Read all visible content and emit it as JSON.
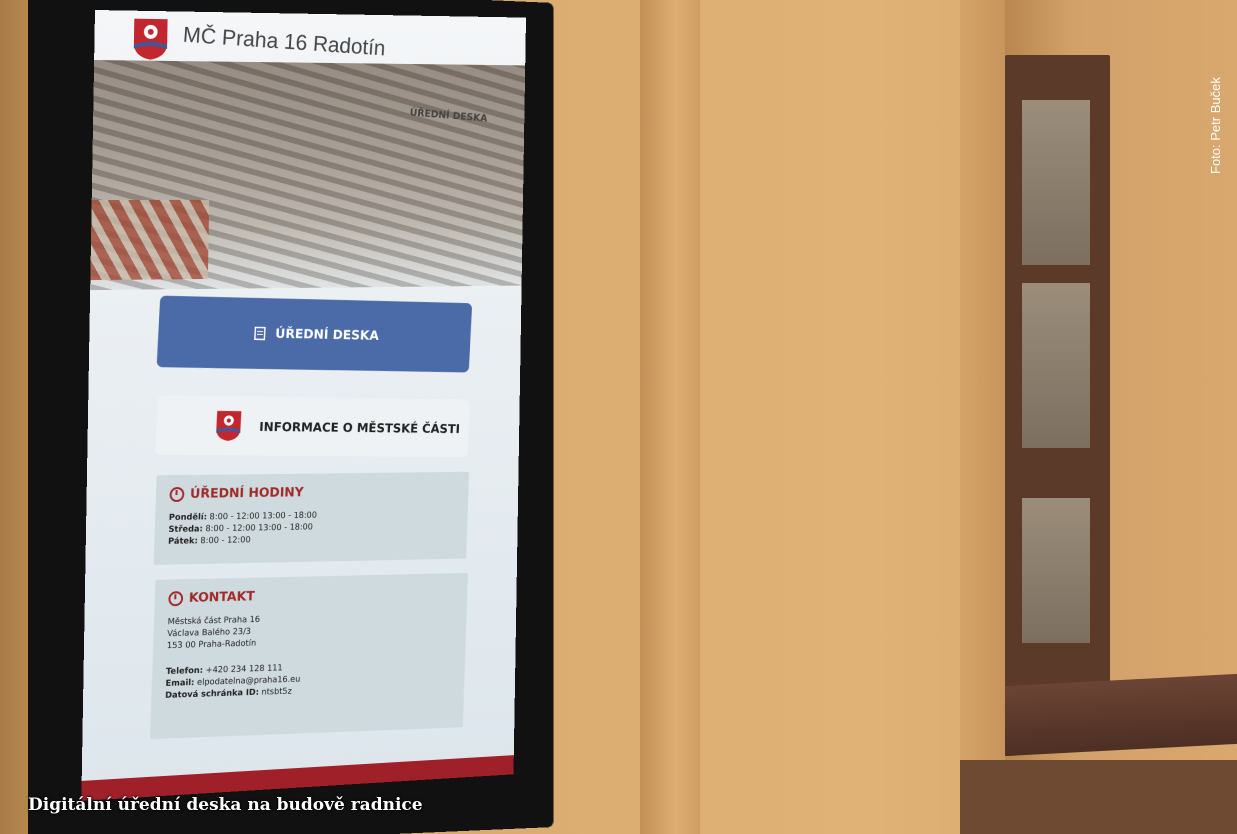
{
  "screen": {
    "header_title": "MČ Praha 16 Radotín",
    "header_section": "ÚŘEDNÍ DESKA",
    "primary_button": "ÚŘEDNÍ DESKA",
    "secondary_button": "INFORMACE O MĚSTSKÉ ČÁSTI",
    "hours": {
      "title": "ÚŘEDNÍ HODINY",
      "rows": [
        {
          "day": "Pondělí:",
          "time": "8:00 - 12:00 13:00 - 18:00"
        },
        {
          "day": "Středa:",
          "time": "8:00 - 12:00 13:00 - 18:00"
        },
        {
          "day": "Pátek:",
          "time": "8:00 - 12:00"
        }
      ]
    },
    "contact": {
      "title": "KONTAKT",
      "address": [
        "Městská část Praha 16",
        "Václava Balého 23/3",
        "153 00 Praha-Radotín"
      ],
      "phone_label": "Telefon:",
      "phone": "+420 234 128 111",
      "email_label": "Email:",
      "email": "elpodatelna@praha16.eu",
      "databox_label": "Datová schránka ID:",
      "databox": "ntsbt5z"
    }
  },
  "caption": "Digitální úřední deska na budově radnice",
  "photo_credit": "Foto: Petr Buček",
  "colors": {
    "primary_button": "#4a6aa8",
    "accent_red": "#a02a2a",
    "footer": "#a0202a"
  }
}
